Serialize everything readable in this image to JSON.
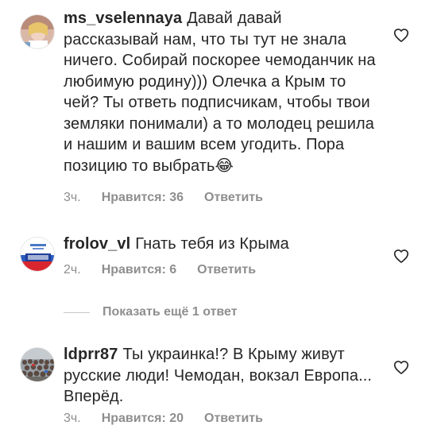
{
  "comments": [
    {
      "username": "ms_vselennaya",
      "text": "Давай давай рассказывай нам, что ты тут не знала ничего. Собирай поскорее чемоданчик на любимую родину))) Олечка а Крым то чей? Ты ответь подписчикам, чтобы твои земляки понимали) а то молодец решила и нашим и вашим всем угодить. Пора позицию то выбрать",
      "emoji": "😂",
      "time": "3ч.",
      "likes": "Нравится: 36",
      "reply": "Ответить",
      "avatar_icon": "avatar-photo"
    },
    {
      "username": "frolov_vl",
      "text": "Гнать тебя из Крыма",
      "time": "2ч.",
      "likes": "Нравится: 6",
      "reply": "Ответить",
      "avatar_icon": "avatar-flag-graphic"
    },
    {
      "username": "ldprr87",
      "text": "Ты украинка!? В Крыму живут русские люди! Чемодан, вокзал Европа... Вперёд.",
      "time": "3ч.",
      "likes": "Нравится: 20",
      "reply": "Ответить",
      "avatar_icon": "avatar-crowd-photo"
    }
  ],
  "more_replies_label": "Показать ещё 1 ответ",
  "colors": {
    "text": "#262626",
    "secondary": "#8e8e8e",
    "divider": "#c7c7c7"
  },
  "icons": {
    "like": "heart-outline-icon"
  }
}
